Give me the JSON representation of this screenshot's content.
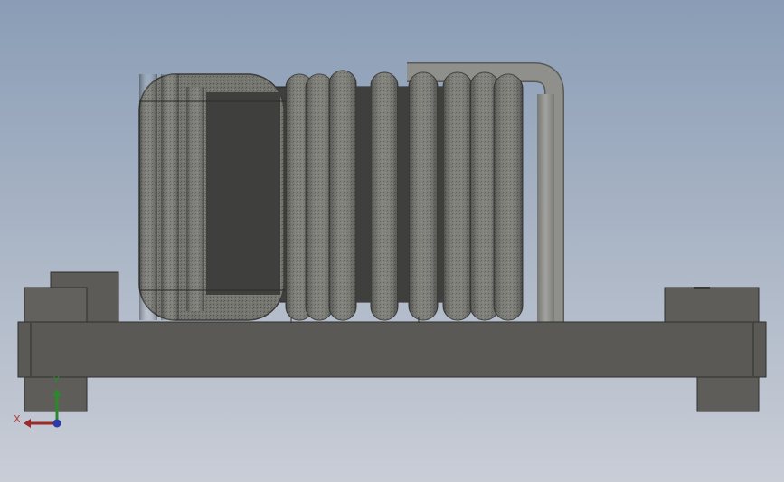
{
  "viewport": {
    "background_top": "#8a9db6",
    "background_bottom": "#c9cdd6"
  },
  "model": {
    "part": "inductor-coil-on-mounting-base",
    "colors": {
      "base_plate": "#5a5956",
      "base_edge": "#2e2e2c",
      "winding": "#767670",
      "winding_dark": "#4a4a46",
      "core": "#3e3e3c",
      "lead_wire": "#8c8c89"
    }
  },
  "triad": {
    "x_label": "X",
    "y_label": "Y",
    "x_color": "#9c2a2a",
    "y_color": "#2a8a2a",
    "z_color": "#2a3aa8"
  }
}
